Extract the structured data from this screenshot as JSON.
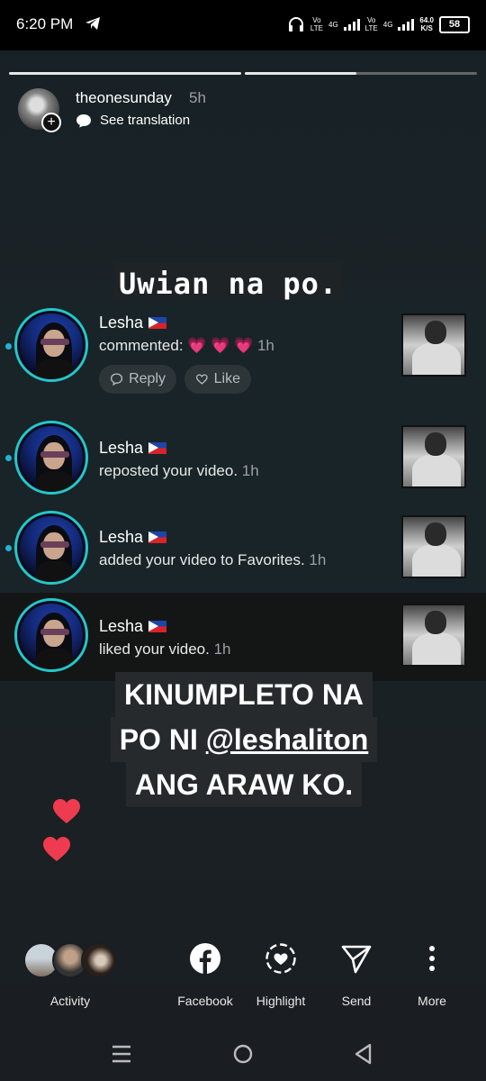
{
  "status_bar": {
    "time": "6:20 PM",
    "network1": "Vo\nLTE",
    "net_4g_1": "4G",
    "network2": "Vo\nLTE",
    "net_4g_2": "4G",
    "speed": "64.0\nK/S",
    "battery": "58"
  },
  "story": {
    "progress": [
      1.0,
      0.48
    ],
    "username": "theonesunday",
    "time_ago": "5h",
    "translate_label": "See translation",
    "caption_top": "Uwian na po.",
    "caption_bottom": {
      "line1": "KINUMPLETO NA",
      "line2_prefix": "PO NI ",
      "line2_mention": "@leshaliton",
      "line3": "ANG ARAW KO."
    }
  },
  "notifications": [
    {
      "name": "Lesha",
      "action": "commented: ",
      "extra": "💗 💗 💗",
      "time": "1h",
      "unread": true
    },
    {
      "name": "Lesha",
      "action": "reposted your video.",
      "time": "1h",
      "unread": true
    },
    {
      "name": "Lesha",
      "action": "added your video to Favorites.",
      "time": "1h",
      "unread": true
    },
    {
      "name": "Lesha",
      "action": "liked your video.",
      "time": "1h",
      "unread": false
    }
  ],
  "buttons": {
    "reply": "Reply",
    "like": "Like"
  },
  "bottom_bar": {
    "activity": "Activity",
    "facebook": "Facebook",
    "highlight": "Highlight",
    "send": "Send",
    "more": "More"
  },
  "colors": {
    "accent_ring": "#24c7c9",
    "unread_dot": "#21b3d6",
    "heart": "#ef3b4f"
  }
}
